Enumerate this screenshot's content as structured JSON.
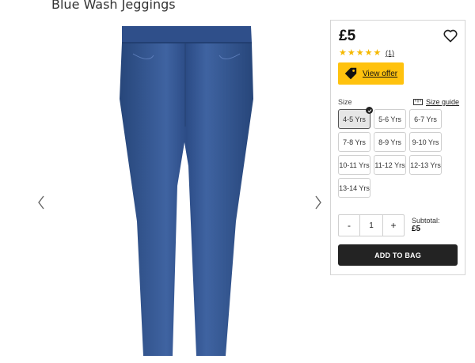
{
  "product": {
    "title": "Blue Wash Jeggings"
  },
  "buy_panel": {
    "price": "£5",
    "rating": {
      "stars": 5,
      "review_count": "(1)"
    },
    "offer_button": "View offer",
    "size_label": "Size",
    "size_guide_label": "Size guide",
    "sizes": [
      "4-5 Yrs",
      "5-6 Yrs",
      "6-7 Yrs",
      "7-8 Yrs",
      "8-9 Yrs",
      "9-10 Yrs",
      "10-11 Yrs",
      "11-12 Yrs",
      "12-13 Yrs",
      "13-14 Yrs"
    ],
    "selected_size": "4-5 Yrs",
    "quantity": {
      "minus": "-",
      "value": "1",
      "plus": "+"
    },
    "subtotal_label": "Subtotal:",
    "subtotal_value": "£5",
    "add_to_bag": "ADD TO BAG"
  },
  "colors": {
    "accent_yellow": "#ffc20e",
    "button_dark": "#232323",
    "star": "#f5b800",
    "denim": "#2f4f86"
  },
  "icons": [
    "chevron-left-icon",
    "chevron-right-icon",
    "heart-icon",
    "star-icon",
    "tag-icon",
    "ruler-icon",
    "check-icon"
  ]
}
